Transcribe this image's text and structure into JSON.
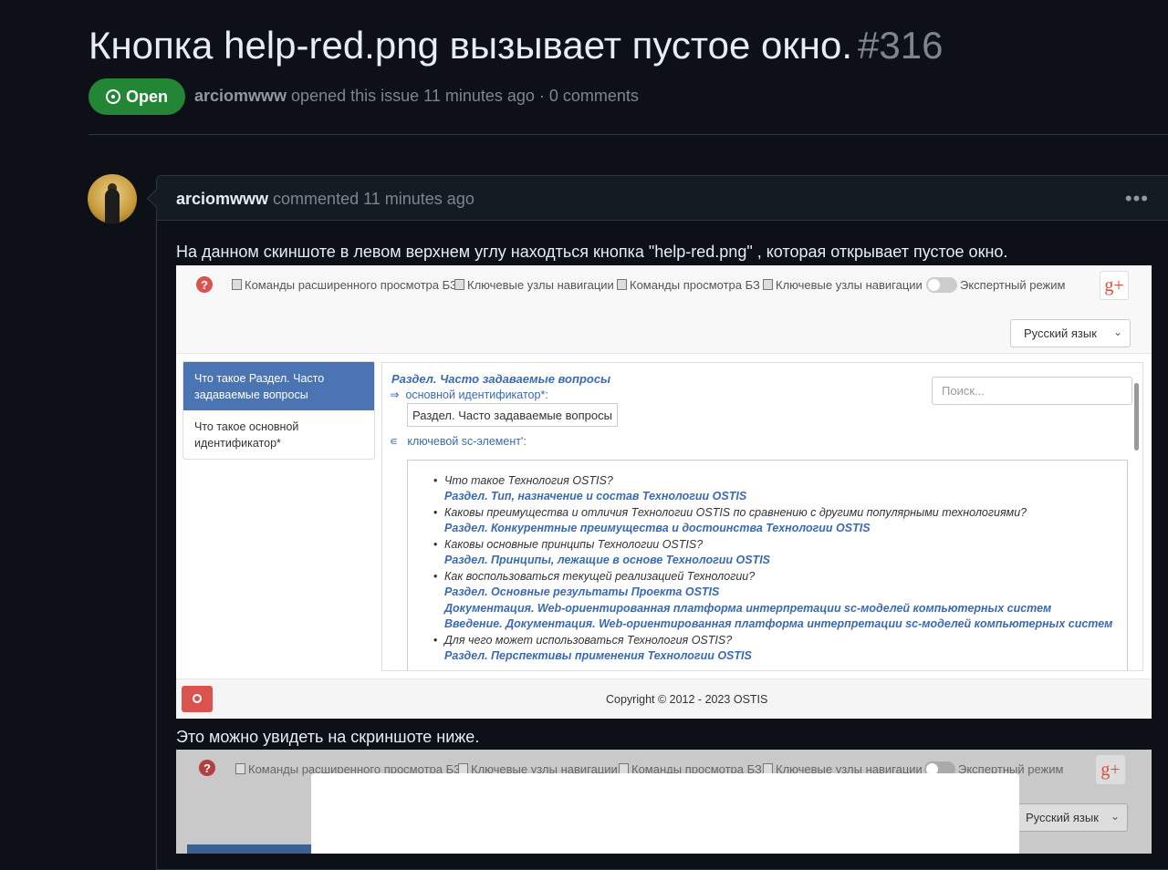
{
  "issue": {
    "title": "Кнопка help-red.png вызывает пустое окно.",
    "number": "#316",
    "status": "Open",
    "author": "arciomwww",
    "meta_text": "opened this issue 11 minutes ago · 0 comments"
  },
  "comment": {
    "author": "arciomwww",
    "time_text": "commented 11 minutes ago",
    "menu": "•••",
    "paragraph1": "На данном скиншоте в левом верхнем углу находться кнопка \"help-red.png\" , которая открывает пустое окно.",
    "paragraph2": "Это можно увидеть на скриншоте ниже."
  },
  "screenshot1": {
    "help_icon": "?",
    "nav": [
      "Команды расширенного просмотра БЗ",
      "Ключевые узлы навигации",
      "Команды просмотра БЗ",
      "Ключевые узлы навигации"
    ],
    "expert_mode": "Экспертный режим",
    "gplus": "g+",
    "language": "Русский язык",
    "sidebar": [
      "Что такое Раздел. Часто задаваемые вопросы",
      "Что такое основной идентификатор*"
    ],
    "content_title": "Раздел. Часто задаваемые вопросы",
    "rel1_arrow": "⇒",
    "rel1": "основной идентификатор*:",
    "identifier_box": "Раздел. Часто задаваемые вопросы",
    "rel2_arrow": "∊",
    "rel2": "ключевой sc-элемент':",
    "search_placeholder": "Поиск...",
    "list": [
      {
        "type": "q",
        "text": "Что такое Технология OSTIS?"
      },
      {
        "type": "a",
        "text": "Раздел. Тип, назначение и состав Технологии OSTIS"
      },
      {
        "type": "q",
        "text": "Каковы преимущества и отличия Технологии OSTIS по сравнению с другими популярными технологиями?"
      },
      {
        "type": "a",
        "text": "Раздел. Конкурентные преимущества и достоинства Технологии OSTIS"
      },
      {
        "type": "q",
        "text": "Каковы основные принципы Технологии OSTIS?"
      },
      {
        "type": "a",
        "text": "Раздел. Принципы, лежащие в основе Технологии OSTIS"
      },
      {
        "type": "q",
        "text": "Как воспользоваться текущей реализацией Технологии?"
      },
      {
        "type": "a",
        "text": "Раздел. Основные результаты Проекта OSTIS"
      },
      {
        "type": "a",
        "text": "Документация. Web-ориентированная платформа интерпретации sc-моделей компьютерных систем"
      },
      {
        "type": "a",
        "text": "Введение. Документация. Web-ориентированная платформа интерпретации sc-моделей компьютерных систем"
      },
      {
        "type": "q",
        "text": "Для чего может использоваться Технология OSTIS?"
      },
      {
        "type": "a",
        "text": "Раздел. Перспективы применения Технологии OSTIS"
      }
    ],
    "copyright": "Copyright © 2012 - 2023 OSTIS"
  },
  "screenshot2": {
    "help_icon": "?",
    "nav": [
      "Команды расширенного просмотра БЗ",
      "Ключевые узлы навигации",
      "Команды просмотра БЗ",
      "Ключевые узлы навигации"
    ],
    "expert_mode": "Экспертный режим",
    "gplus": "g+",
    "language": "Русский язык"
  },
  "colors": {
    "background": "#0d1117",
    "open_badge": "#238636",
    "link_blue": "#3a6ab1",
    "help_red": "#d9534f"
  },
  "icons": [
    "issue-open-icon",
    "kebab-icon",
    "help-icon",
    "glyph-icon",
    "toggle-icon",
    "google-plus-icon",
    "chevron-down-icon",
    "scroll-thumb",
    "stop-icon"
  ]
}
